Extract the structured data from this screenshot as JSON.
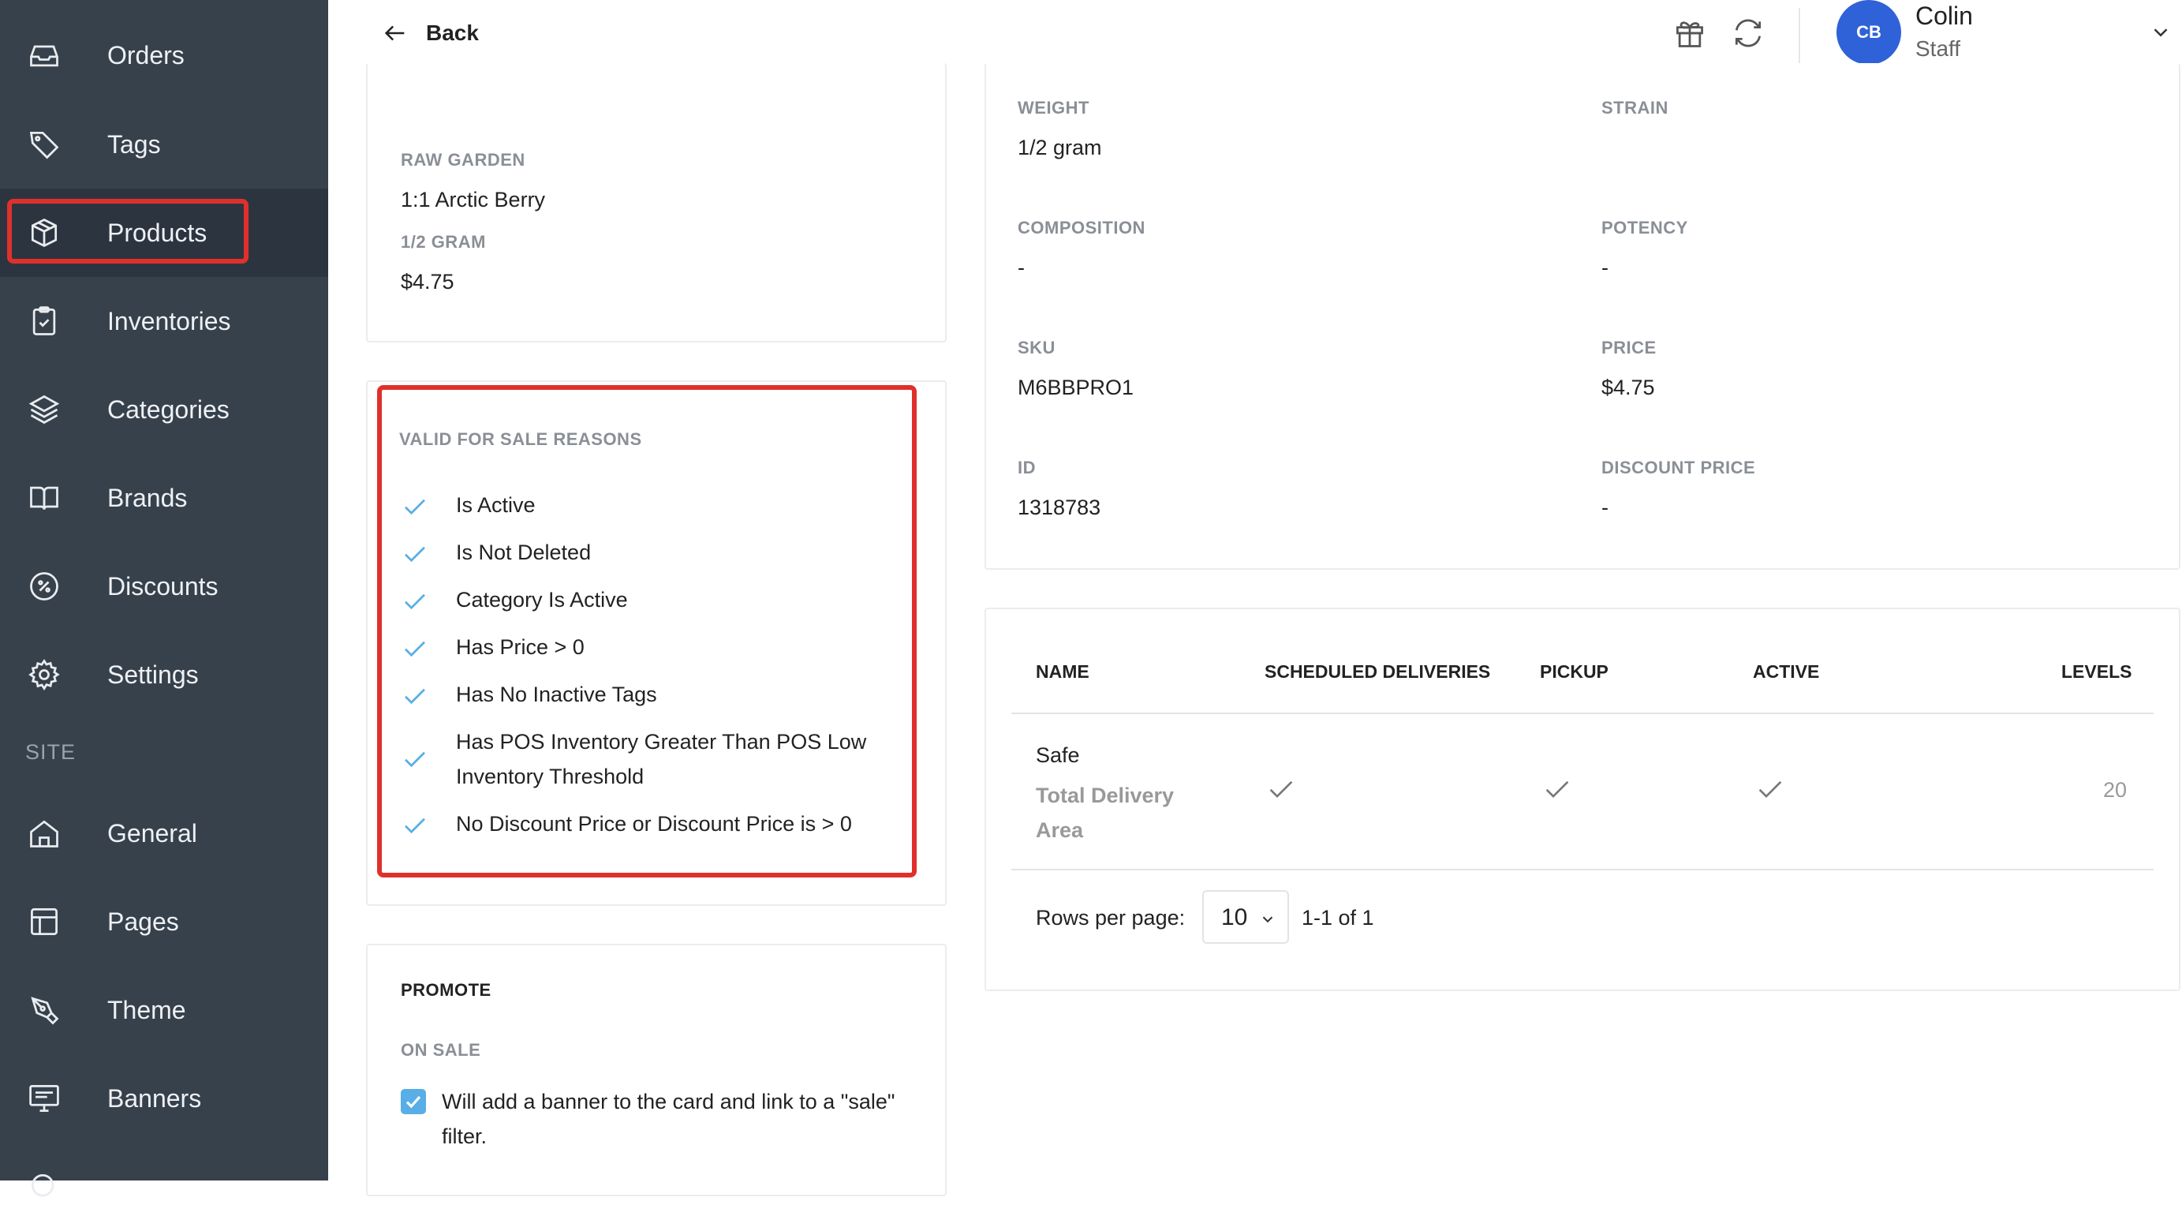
{
  "sidebar": {
    "items": [
      {
        "label": "Orders",
        "icon": "inbox-icon"
      },
      {
        "label": "Tags",
        "icon": "tag-icon"
      },
      {
        "label": "Products",
        "icon": "cube-icon"
      },
      {
        "label": "Inventories",
        "icon": "clipboard-icon"
      },
      {
        "label": "Categories",
        "icon": "layers-icon"
      },
      {
        "label": "Brands",
        "icon": "book-icon"
      },
      {
        "label": "Discounts",
        "icon": "percent-icon"
      },
      {
        "label": "Settings",
        "icon": "gear-icon"
      },
      {
        "label": "General",
        "icon": "home-icon"
      },
      {
        "label": "Pages",
        "icon": "layout-icon"
      },
      {
        "label": "Theme",
        "icon": "pen-icon"
      },
      {
        "label": "Banners",
        "icon": "monitor-icon"
      }
    ],
    "section_label": "SITE",
    "active": "Products"
  },
  "header": {
    "back_label": "Back",
    "user_initials": "CB",
    "user_name": "Colin",
    "user_role": "Staff"
  },
  "product_card": {
    "brand": "RAW GARDEN",
    "name": "1:1 Arctic Berry",
    "size": "1/2 GRAM",
    "price": "$4.75"
  },
  "reasons": {
    "title": "VALID FOR SALE REASONS",
    "items": [
      "Is Active",
      "Is Not Deleted",
      "Category Is Active",
      "Has Price > 0",
      "Has No Inactive Tags",
      "Has POS Inventory Greater Than POS Low Inventory Threshold",
      "No Discount Price or Discount Price is > 0"
    ]
  },
  "promote": {
    "title": "PROMOTE",
    "on_sale_label": "ON SALE",
    "on_sale_text": "Will add a banner to the card and link to a \"sale\" filter.",
    "on_sale_checked": true
  },
  "details": {
    "weight_label": "WEIGHT",
    "weight": "1/2 gram",
    "strain_label": "STRAIN",
    "strain": "",
    "composition_label": "COMPOSITION",
    "composition": "-",
    "potency_label": "POTENCY",
    "potency": "-",
    "sku_label": "SKU",
    "sku": "M6BBPRO1",
    "price_label": "PRICE",
    "price": "$4.75",
    "id_label": "ID",
    "id": "1318783",
    "discount_label": "DISCOUNT PRICE",
    "discount": "-"
  },
  "zones_table": {
    "headers": [
      "NAME",
      "SCHEDULED DELIVERIES",
      "PICKUP",
      "ACTIVE",
      "LEVELS"
    ],
    "rows": [
      {
        "name": "Safe",
        "subname": "Total Delivery Area",
        "scheduled": true,
        "pickup": true,
        "active": true,
        "levels": "20"
      }
    ],
    "rows_per_page_label": "Rows per page:",
    "rows_per_page": "10",
    "range": "1-1 of 1"
  },
  "colors": {
    "sidebar_bg": "#37414c",
    "accent_blue": "#2f62d8",
    "check_blue": "#58aee6",
    "highlight_red": "#e0302b"
  }
}
